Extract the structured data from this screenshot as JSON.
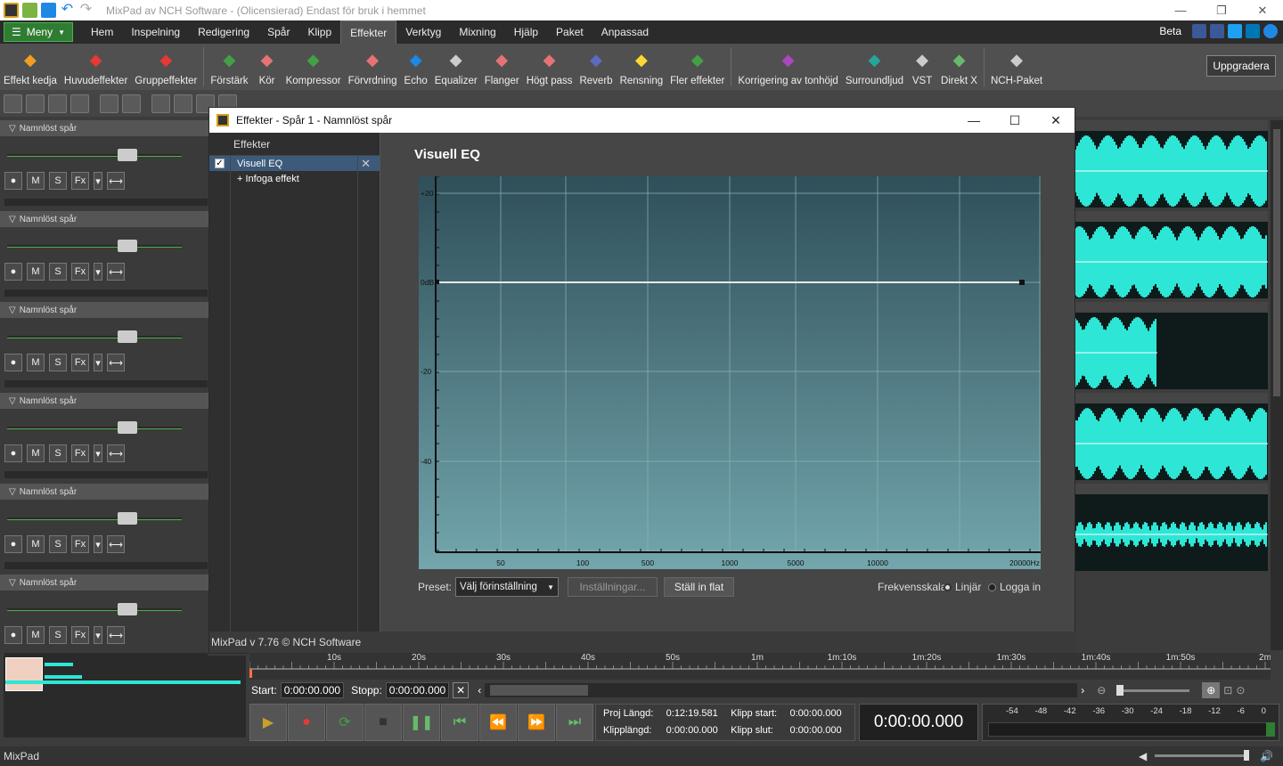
{
  "app": {
    "title": "MixPad av NCH Software - (Olicensierad) Endast för bruk i hemmet",
    "status": "MixPad",
    "version": "MixPad v 7.76 © NCH Software"
  },
  "menu": {
    "main_label": "Meny",
    "tabs": [
      "Hem",
      "Inspelning",
      "Redigering",
      "Spår",
      "Klipp",
      "Effekter",
      "Verktyg",
      "Mixning",
      "Hjälp",
      "Paket",
      "Anpassad"
    ],
    "active_tab": "Effekter",
    "beta": "Beta"
  },
  "ribbon": {
    "items": [
      {
        "label": "Effekt kedja",
        "icon": "hand-icon"
      },
      {
        "label": "Huvudeffekter",
        "icon": "fx-icon"
      },
      {
        "label": "Gruppeffekter",
        "icon": "group-fx-icon"
      },
      {
        "label": "Förstärk",
        "icon": "amplify-icon"
      },
      {
        "label": "Kör",
        "icon": "chorus-icon"
      },
      {
        "label": "Kompressor",
        "icon": "compressor-icon"
      },
      {
        "label": "Förvrdning",
        "icon": "distortion-icon"
      },
      {
        "label": "Echo",
        "icon": "echo-icon"
      },
      {
        "label": "Equalizer",
        "icon": "equalizer-icon"
      },
      {
        "label": "Flanger",
        "icon": "flanger-icon"
      },
      {
        "label": "Högt pass",
        "icon": "highpass-icon"
      },
      {
        "label": "Reverb",
        "icon": "reverb-icon"
      },
      {
        "label": "Rensning",
        "icon": "cleanup-icon"
      },
      {
        "label": "Fler effekter",
        "icon": "more-effects-icon"
      },
      {
        "label": "Korrigering av tonhöjd",
        "icon": "pitch-correction-icon"
      },
      {
        "label": "Surroundljud",
        "icon": "surround-icon"
      },
      {
        "label": "VST",
        "icon": "vst-icon"
      },
      {
        "label": "Direkt X",
        "icon": "directx-icon"
      },
      {
        "label": "NCH-Paket",
        "icon": "nch-suite-icon"
      }
    ],
    "upgrade": "Uppgradera"
  },
  "tracks": {
    "name": "Namnlöst spår",
    "buttons": [
      "M",
      "S",
      "Fx"
    ]
  },
  "dialog": {
    "title": "Effekter - Spår 1 - Namnlöst spår",
    "list_header": "Effekter",
    "effect": "Visuell EQ",
    "insert": "+ Infoga effekt",
    "eq_title": "Visuell EQ",
    "db_labels": [
      "+20",
      "0dB",
      "-20",
      "-40"
    ],
    "freq_labels": [
      "50",
      "100",
      "500",
      "1000",
      "5000",
      "10000",
      "20000Hz"
    ],
    "preset_label": "Preset:",
    "preset_value": "Välj förinställning",
    "settings": "Inställningar...",
    "flat": "Ställ in flat",
    "scale_label": "Frekvensskala",
    "linear": "Linjär",
    "log": "Logga in"
  },
  "timeline": {
    "marks": [
      "10s",
      "20s",
      "30s",
      "40s",
      "50s",
      "1m",
      "1m:10s",
      "1m:20s",
      "1m:30s",
      "1m:40s",
      "1m:50s",
      "2m"
    ],
    "start_label": "Start:",
    "start_value": "0:00:00.000",
    "stop_label": "Stopp:",
    "stop_value": "0:00:00.000"
  },
  "info": {
    "proj_len_label": "Proj Längd:",
    "proj_len": "0:12:19.581",
    "clip_start_label": "Klipp start:",
    "clip_start": "0:00:00.000",
    "clip_len_label": "Klipplängd:",
    "clip_len": "0:00:00.000",
    "clip_end_label": "Klipp slut:",
    "clip_end": "0:00:00.000",
    "time": "0:00:00.000"
  },
  "meter": {
    "labels": [
      "-54",
      "-48",
      "-42",
      "-36",
      "-30",
      "-24",
      "-18",
      "-12",
      "-6",
      "0"
    ]
  }
}
